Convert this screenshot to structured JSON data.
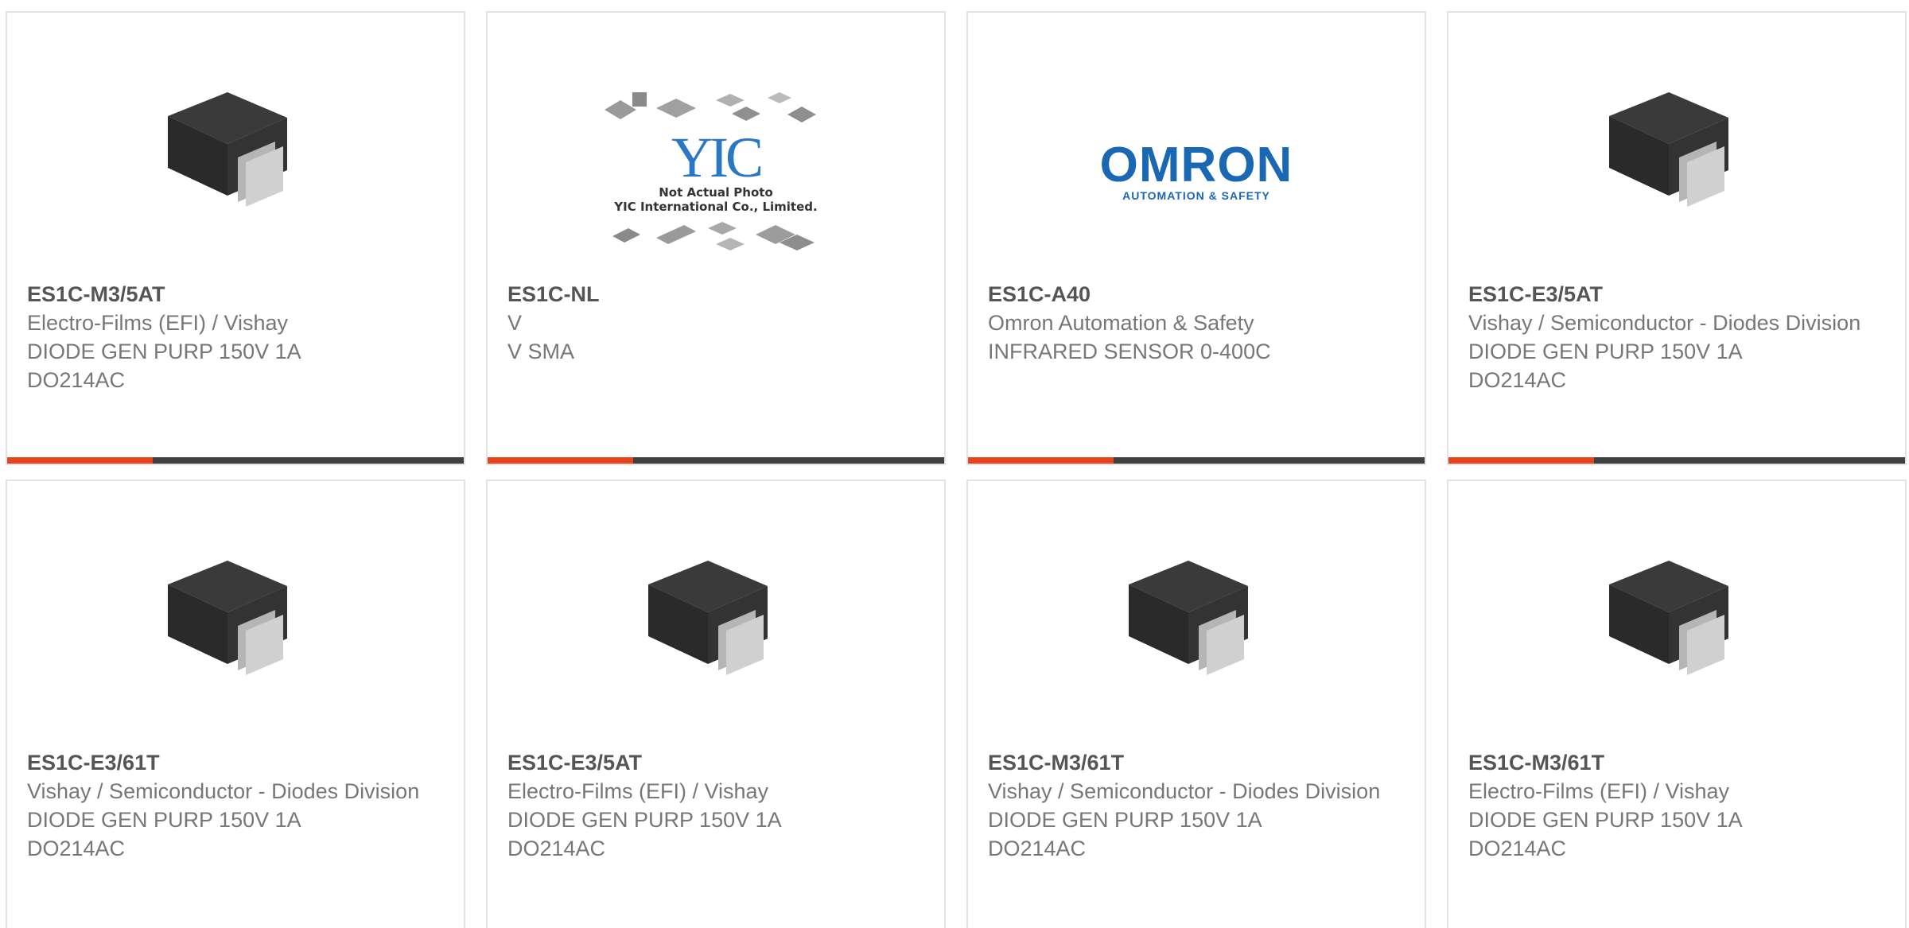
{
  "products": [
    {
      "part": "ES1C-M3/5AT",
      "maker": "Electro-Films (EFI) / Vishay",
      "desc": "DIODE GEN PURP 150V 1A DO214AC",
      "image": "diode-package-icon"
    },
    {
      "part": "ES1C-NL",
      "maker": "V",
      "desc": "V SMA",
      "image": "yic-placeholder-logo",
      "logo_text": "YIC",
      "caption_line1": "Not Actual Photo",
      "caption_line2": "YIC International Co., Limited."
    },
    {
      "part": "ES1C-A40",
      "maker": "Omron Automation & Safety",
      "desc": "INFRARED SENSOR 0-400C",
      "image": "omron-logo",
      "logo_text": "OMRON",
      "logo_sub": "AUTOMATION & SAFETY"
    },
    {
      "part": "ES1C-E3/5AT",
      "maker": "Vishay / Semiconductor - Diodes Division",
      "desc": "DIODE GEN PURP 150V 1A DO214AC",
      "image": "diode-package-icon"
    },
    {
      "part": "ES1C-E3/61T",
      "maker": "Vishay / Semiconductor - Diodes Division",
      "desc": "DIODE GEN PURP 150V 1A DO214AC",
      "image": "diode-package-icon"
    },
    {
      "part": "ES1C-E3/5AT",
      "maker": "Electro-Films (EFI) / Vishay",
      "desc": "DIODE GEN PURP 150V 1A DO214AC",
      "image": "diode-package-icon"
    },
    {
      "part": "ES1C-M3/61T",
      "maker": "Vishay / Semiconductor - Diodes Division",
      "desc": "DIODE GEN PURP 150V 1A DO214AC",
      "image": "diode-package-icon"
    },
    {
      "part": "ES1C-M3/61T",
      "maker": "Electro-Films (EFI) / Vishay",
      "desc": "DIODE GEN PURP 150V 1A DO214AC",
      "image": "diode-package-icon"
    }
  ],
  "colors": {
    "accent": "#e8431b",
    "bar": "#404040",
    "border": "#e3e3e3",
    "brand_omron": "#1a68b3",
    "brand_yic": "#2a78c4"
  }
}
